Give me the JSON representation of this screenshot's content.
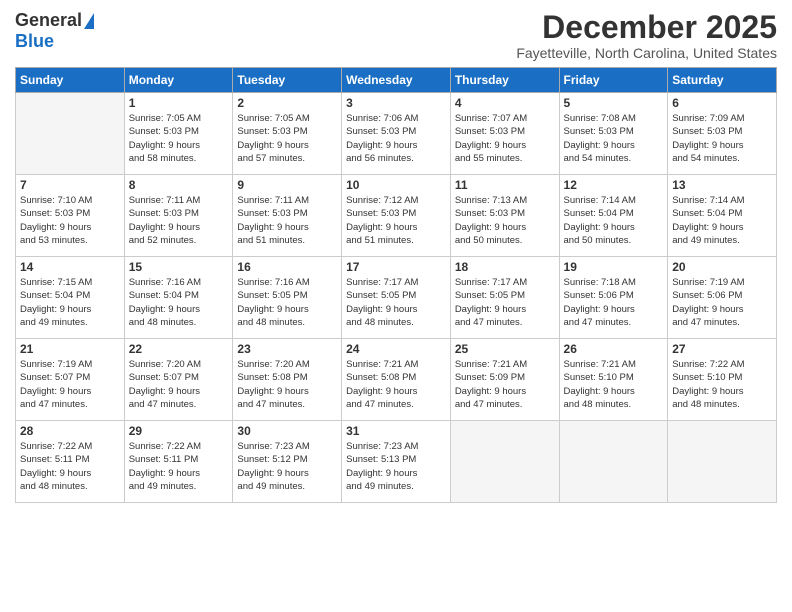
{
  "logo": {
    "general": "General",
    "blue": "Blue"
  },
  "header": {
    "month": "December 2025",
    "location": "Fayetteville, North Carolina, United States"
  },
  "days_of_week": [
    "Sunday",
    "Monday",
    "Tuesday",
    "Wednesday",
    "Thursday",
    "Friday",
    "Saturday"
  ],
  "weeks": [
    [
      {
        "day": "",
        "info": ""
      },
      {
        "day": "1",
        "info": "Sunrise: 7:05 AM\nSunset: 5:03 PM\nDaylight: 9 hours\nand 58 minutes."
      },
      {
        "day": "2",
        "info": "Sunrise: 7:05 AM\nSunset: 5:03 PM\nDaylight: 9 hours\nand 57 minutes."
      },
      {
        "day": "3",
        "info": "Sunrise: 7:06 AM\nSunset: 5:03 PM\nDaylight: 9 hours\nand 56 minutes."
      },
      {
        "day": "4",
        "info": "Sunrise: 7:07 AM\nSunset: 5:03 PM\nDaylight: 9 hours\nand 55 minutes."
      },
      {
        "day": "5",
        "info": "Sunrise: 7:08 AM\nSunset: 5:03 PM\nDaylight: 9 hours\nand 54 minutes."
      },
      {
        "day": "6",
        "info": "Sunrise: 7:09 AM\nSunset: 5:03 PM\nDaylight: 9 hours\nand 54 minutes."
      }
    ],
    [
      {
        "day": "7",
        "info": "Sunrise: 7:10 AM\nSunset: 5:03 PM\nDaylight: 9 hours\nand 53 minutes."
      },
      {
        "day": "8",
        "info": "Sunrise: 7:11 AM\nSunset: 5:03 PM\nDaylight: 9 hours\nand 52 minutes."
      },
      {
        "day": "9",
        "info": "Sunrise: 7:11 AM\nSunset: 5:03 PM\nDaylight: 9 hours\nand 51 minutes."
      },
      {
        "day": "10",
        "info": "Sunrise: 7:12 AM\nSunset: 5:03 PM\nDaylight: 9 hours\nand 51 minutes."
      },
      {
        "day": "11",
        "info": "Sunrise: 7:13 AM\nSunset: 5:03 PM\nDaylight: 9 hours\nand 50 minutes."
      },
      {
        "day": "12",
        "info": "Sunrise: 7:14 AM\nSunset: 5:04 PM\nDaylight: 9 hours\nand 50 minutes."
      },
      {
        "day": "13",
        "info": "Sunrise: 7:14 AM\nSunset: 5:04 PM\nDaylight: 9 hours\nand 49 minutes."
      }
    ],
    [
      {
        "day": "14",
        "info": "Sunrise: 7:15 AM\nSunset: 5:04 PM\nDaylight: 9 hours\nand 49 minutes."
      },
      {
        "day": "15",
        "info": "Sunrise: 7:16 AM\nSunset: 5:04 PM\nDaylight: 9 hours\nand 48 minutes."
      },
      {
        "day": "16",
        "info": "Sunrise: 7:16 AM\nSunset: 5:05 PM\nDaylight: 9 hours\nand 48 minutes."
      },
      {
        "day": "17",
        "info": "Sunrise: 7:17 AM\nSunset: 5:05 PM\nDaylight: 9 hours\nand 48 minutes."
      },
      {
        "day": "18",
        "info": "Sunrise: 7:17 AM\nSunset: 5:05 PM\nDaylight: 9 hours\nand 47 minutes."
      },
      {
        "day": "19",
        "info": "Sunrise: 7:18 AM\nSunset: 5:06 PM\nDaylight: 9 hours\nand 47 minutes."
      },
      {
        "day": "20",
        "info": "Sunrise: 7:19 AM\nSunset: 5:06 PM\nDaylight: 9 hours\nand 47 minutes."
      }
    ],
    [
      {
        "day": "21",
        "info": "Sunrise: 7:19 AM\nSunset: 5:07 PM\nDaylight: 9 hours\nand 47 minutes."
      },
      {
        "day": "22",
        "info": "Sunrise: 7:20 AM\nSunset: 5:07 PM\nDaylight: 9 hours\nand 47 minutes."
      },
      {
        "day": "23",
        "info": "Sunrise: 7:20 AM\nSunset: 5:08 PM\nDaylight: 9 hours\nand 47 minutes."
      },
      {
        "day": "24",
        "info": "Sunrise: 7:21 AM\nSunset: 5:08 PM\nDaylight: 9 hours\nand 47 minutes."
      },
      {
        "day": "25",
        "info": "Sunrise: 7:21 AM\nSunset: 5:09 PM\nDaylight: 9 hours\nand 47 minutes."
      },
      {
        "day": "26",
        "info": "Sunrise: 7:21 AM\nSunset: 5:10 PM\nDaylight: 9 hours\nand 48 minutes."
      },
      {
        "day": "27",
        "info": "Sunrise: 7:22 AM\nSunset: 5:10 PM\nDaylight: 9 hours\nand 48 minutes."
      }
    ],
    [
      {
        "day": "28",
        "info": "Sunrise: 7:22 AM\nSunset: 5:11 PM\nDaylight: 9 hours\nand 48 minutes."
      },
      {
        "day": "29",
        "info": "Sunrise: 7:22 AM\nSunset: 5:11 PM\nDaylight: 9 hours\nand 49 minutes."
      },
      {
        "day": "30",
        "info": "Sunrise: 7:23 AM\nSunset: 5:12 PM\nDaylight: 9 hours\nand 49 minutes."
      },
      {
        "day": "31",
        "info": "Sunrise: 7:23 AM\nSunset: 5:13 PM\nDaylight: 9 hours\nand 49 minutes."
      },
      {
        "day": "",
        "info": ""
      },
      {
        "day": "",
        "info": ""
      },
      {
        "day": "",
        "info": ""
      }
    ]
  ]
}
